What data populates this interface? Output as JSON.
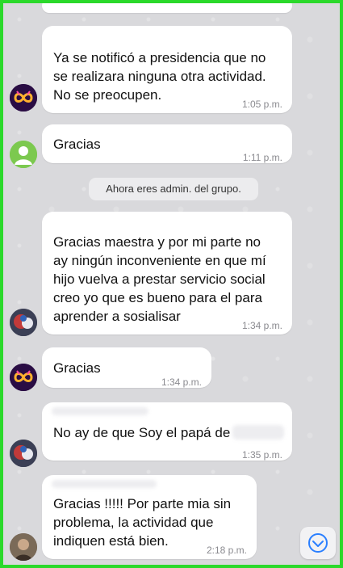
{
  "messages": [
    {
      "text": "Ya se notificó a presidencia que no\nse realizara ninguna otra actividad.\nNo se preocupen.",
      "time": "1:05 p.m."
    },
    {
      "text": "Gracias",
      "time": "1:11 p.m."
    },
    {
      "text": "Gracias maestra y por mi parte no\nay ningún inconveniente en que mí\nhijo vuelva a prestar servicio social\ncreo yo que es bueno para el para\naprender a sosialisar",
      "time": "1:34 p.m."
    },
    {
      "text": "Gracias",
      "time": "1:34 p.m."
    },
    {
      "text": "No ay de que Soy el papá de",
      "time": "1:35 p.m."
    },
    {
      "text": "Gracias !!!!! Por parte mia sin\nproblema, la actividad que\nindiquen está bien.",
      "time": "2:18 p.m."
    }
  ],
  "system_notice": "Ahora eres admin. del grupo.",
  "colors": {
    "frame": "#2bd92b",
    "background": "#d9d9dc",
    "bubble": "#ffffff",
    "scroll_icon": "#2a7fff"
  },
  "icons": {
    "scroll_down": "chevron-down-circle-icon"
  }
}
